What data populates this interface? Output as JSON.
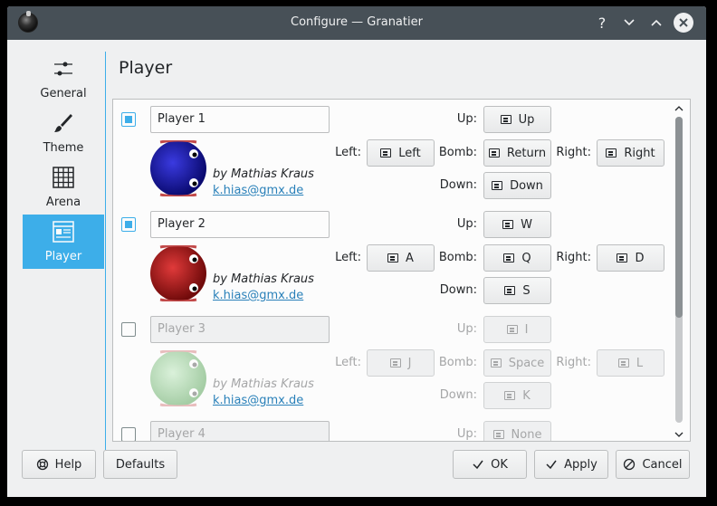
{
  "window": {
    "title": "Configure — Granatier"
  },
  "titlebar": {
    "help_glyph": "?",
    "minimize_glyph": "⌄",
    "maximize_glyph": "⌃",
    "close_glyph": "✕"
  },
  "sidebar": {
    "items": [
      {
        "label": "General",
        "icon": "sliders-icon",
        "selected": false
      },
      {
        "label": "Theme",
        "icon": "brush-icon",
        "selected": false
      },
      {
        "label": "Arena",
        "icon": "grid-icon",
        "selected": false
      },
      {
        "label": "Player",
        "icon": "player-icon",
        "selected": true
      }
    ]
  },
  "page": {
    "title": "Player"
  },
  "key_labels": {
    "up": "Up:",
    "left": "Left:",
    "bomb": "Bomb:",
    "right": "Right:",
    "down": "Down:"
  },
  "players": [
    {
      "enabled": true,
      "name": "Player 1",
      "author": "by Mathias Kraus",
      "email": "k.hias@gmx.de",
      "color": "#1414a8",
      "keys": {
        "up": "Up",
        "left": "Left",
        "bomb": "Return",
        "right": "Right",
        "down": "Down"
      }
    },
    {
      "enabled": true,
      "name": "Player 2",
      "author": "by Mathias Kraus",
      "email": "k.hias@gmx.de",
      "color": "#a81414",
      "keys": {
        "up": "W",
        "left": "A",
        "bomb": "Q",
        "right": "D",
        "down": "S"
      }
    },
    {
      "enabled": false,
      "name": "Player 3",
      "author": "by Mathias Kraus",
      "email": "k.hias@gmx.de",
      "color": "#8fcf8f",
      "keys": {
        "up": "I",
        "left": "J",
        "bomb": "Space",
        "right": "L",
        "down": "K"
      }
    },
    {
      "enabled": false,
      "name": "Player 4",
      "keys": {
        "up": "None"
      }
    }
  ],
  "buttons": {
    "help": "Help",
    "defaults": "Defaults",
    "ok": "OK",
    "apply": "Apply",
    "cancel": "Cancel"
  },
  "colors": {
    "accent": "#3daee9",
    "titlebar": "#475057",
    "link": "#2980b9"
  }
}
